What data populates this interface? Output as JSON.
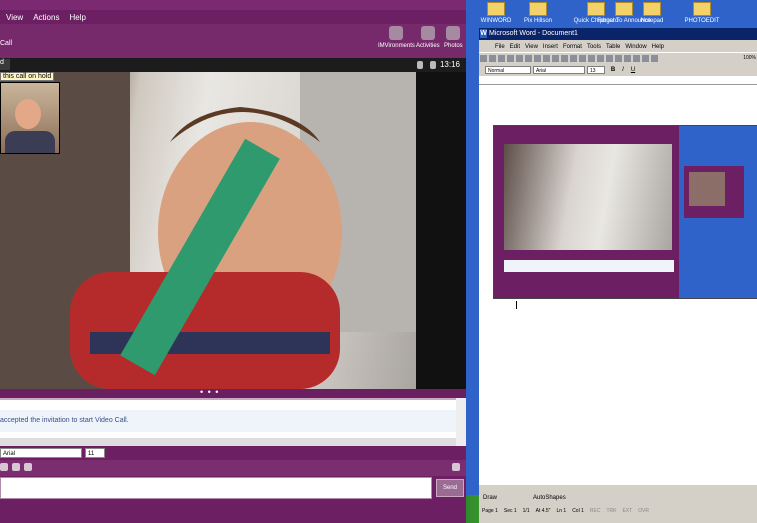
{
  "messenger": {
    "menu": [
      "View",
      "Actions",
      "Help"
    ],
    "call_label": "Call",
    "toolbar": [
      {
        "label": "IMVironments",
        "icon": "imvironments-icon"
      },
      {
        "label": "Activities",
        "icon": "activities-icon"
      },
      {
        "label": "Photos",
        "icon": "photos-icon"
      }
    ],
    "video": {
      "hold_tooltip": "this call on hold",
      "timer": "13:16"
    },
    "chat_log": {
      "message": "accepted the invitation to start Video Call."
    },
    "format": {
      "font": "Arial",
      "size": "11"
    },
    "send_label": "Send"
  },
  "desktop": {
    "icons": [
      {
        "label": "WINWORD"
      },
      {
        "label": "Pix Hillson"
      },
      {
        "label": "Quick Chipboard"
      },
      {
        "label": "Forget To Announce"
      },
      {
        "label": "Notepad"
      },
      {
        "label": "PHOTOEDIT"
      }
    ]
  },
  "word": {
    "title": "Microsoft Word - Document1",
    "menu": [
      "File",
      "Edit",
      "View",
      "Insert",
      "Format",
      "Tools",
      "Table",
      "Window",
      "Help"
    ],
    "style": "Normal",
    "font": "Arial",
    "size": "13",
    "zoom": "100%",
    "draw_label": "Draw",
    "autoshapes_label": "AutoShapes",
    "status": {
      "page": "Page 1",
      "section": "Sec 1",
      "pages": "1/1",
      "at": "At 4.5\"",
      "line": "Ln 1",
      "col": "Col 1",
      "flags": [
        "REC",
        "TRK",
        "EXT",
        "OVR"
      ]
    }
  }
}
